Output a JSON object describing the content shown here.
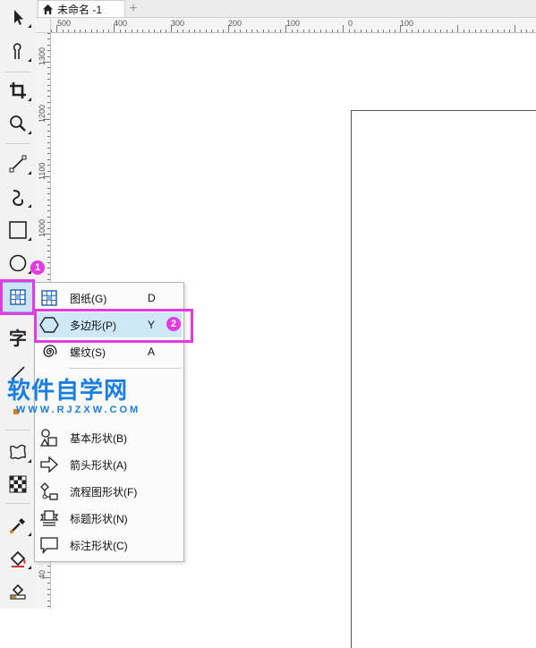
{
  "tab": {
    "title": "未命名 -1",
    "add_label": "+"
  },
  "ruler": {
    "horizontal_labels": [
      "500",
      "400",
      "300",
      "200",
      "100",
      "0",
      "100"
    ],
    "vertical_labels": [
      "1300",
      "1200",
      "1100",
      "1000",
      "40"
    ]
  },
  "toolbox": {
    "tools": [
      "pick-tool",
      "freehand-shape-tool",
      "crop-tool",
      "zoom-tool",
      "freehand-tool",
      "artistic-media-tool",
      "rectangle-tool",
      "ellipse-tool",
      "graph-paper-tool",
      "text-tool",
      "parallel-dimension-tool",
      "connector-tool",
      "envelope-tool",
      "transparency-tool",
      "eyedropper-tool",
      "interactive-fill-tool",
      "smart-fill-tool"
    ],
    "text_tool_label": "字"
  },
  "menu": {
    "items": [
      {
        "label": "图纸(G)",
        "key": "D",
        "icon": "graph-paper-icon"
      },
      {
        "label": "多边形(P)",
        "key": "Y",
        "icon": "polygon-icon"
      },
      {
        "label": "螺纹(S)",
        "key": "A",
        "icon": "spiral-icon"
      },
      {
        "label": "基本形状(B)",
        "key": "",
        "icon": "basic-shapes-icon"
      },
      {
        "label": "箭头形状(A)",
        "key": "",
        "icon": "arrow-shapes-icon"
      },
      {
        "label": "流程图形状(F)",
        "key": "",
        "icon": "flowchart-shapes-icon"
      },
      {
        "label": "标题形状(N)",
        "key": "",
        "icon": "banner-shapes-icon"
      },
      {
        "label": "标注形状(C)",
        "key": "",
        "icon": "callout-shapes-icon"
      }
    ]
  },
  "annotations": {
    "badge1": "1",
    "badge2": "2"
  },
  "watermark": {
    "title": "软件自学网",
    "url": "WWW.RJZXW.COM"
  },
  "colors": {
    "highlight": "#e33be0",
    "menu_active": "#cfe8f8",
    "watermark": "#1a7ee0"
  }
}
